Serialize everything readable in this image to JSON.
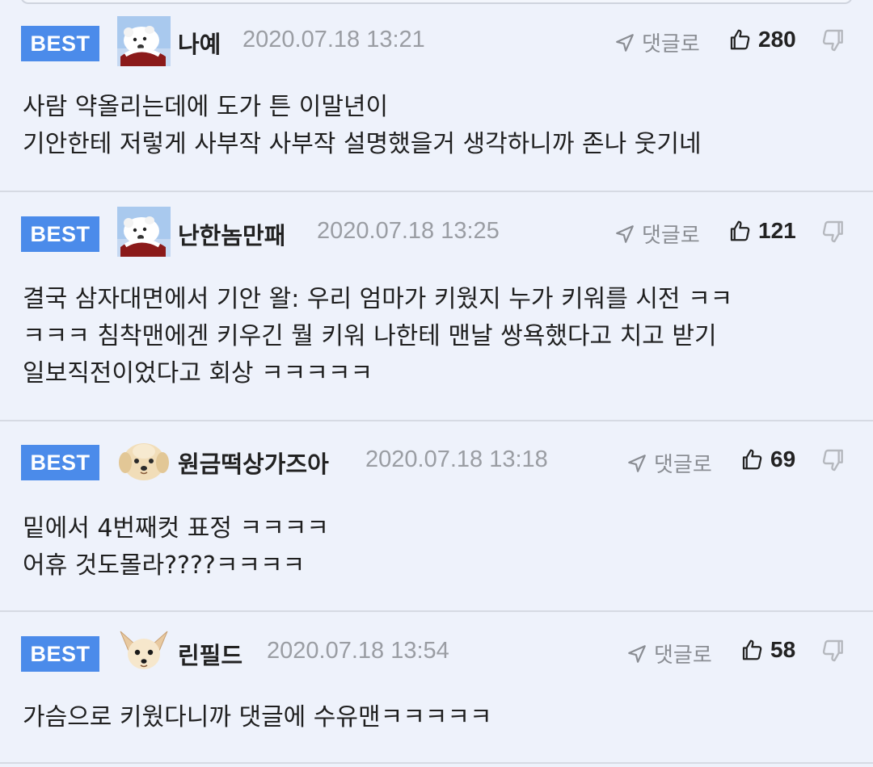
{
  "comments": [
    {
      "badge": "BEST",
      "avatar": "polar-bear-avatar",
      "nickname": "나예",
      "date": "2020.07.18 13:21",
      "reply_label": "댓글로",
      "likes": "280",
      "lines": [
        "사람 약올리는데에 도가 튼 이말년이",
        "기안한테 저렇게 사부작 사부작 설명했을거 생각하니까 존나 웃기네"
      ]
    },
    {
      "badge": "BEST",
      "avatar": "polar-bear-avatar",
      "nickname": "난한놈만패",
      "date": "2020.07.18 13:25",
      "reply_label": "댓글로",
      "likes": "121",
      "lines": [
        "결국 삼자대면에서 기안 왈: 우리 엄마가 키웠지 누가 키워를 시전 ㅋㅋ",
        "ㅋㅋㅋ 침착맨에겐 키우긴 뭘 키워 나한테 맨날 쌍욕했다고 치고 받기",
        "일보직전이었다고 회상 ㅋㅋㅋㅋㅋ"
      ]
    },
    {
      "badge": "BEST",
      "avatar": "puppy-avatar",
      "nickname": "원금떡상가즈아",
      "date": "2020.07.18 13:18",
      "reply_label": "댓글로",
      "likes": "69",
      "lines": [
        "밑에서 4번째컷 표정 ㅋㅋㅋㅋ",
        "어휴 것도몰라????ㅋㅋㅋㅋ"
      ]
    },
    {
      "badge": "BEST",
      "avatar": "chihuahua-avatar",
      "nickname": "린필드",
      "date": "2020.07.18 13:54",
      "reply_label": "댓글로",
      "likes": "58",
      "lines": [
        "가슴으로 키웠다니까 댓글에 수유맨ㅋㅋㅋㅋㅋ"
      ]
    }
  ],
  "colors": {
    "badge_bg": "#4b8bea",
    "background": "#eef2fb",
    "date_text": "#9a9da3",
    "divider": "#d6dae3"
  },
  "icons": {
    "reply": "reply-arrow-icon",
    "like": "thumbs-up-icon",
    "dislike": "thumbs-down-icon"
  }
}
